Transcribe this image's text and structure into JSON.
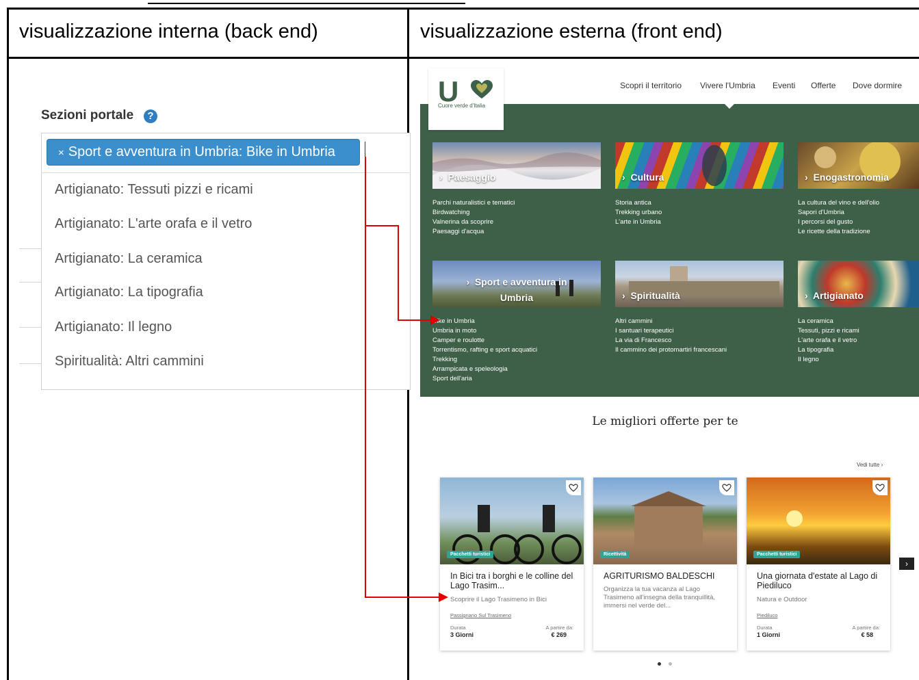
{
  "header": {
    "left_title": "visualizzazione interna (back end)",
    "right_title": "visualizzazione esterna (front end)"
  },
  "backend": {
    "field_label": "Sezioni portale",
    "help_icon": "question-circle-icon",
    "selected_chip": "Sport e avventura in Umbria: Bike in Umbria",
    "chip_remove": "×",
    "options": [
      "Artigianato: Tessuti pizzi e ricami",
      "Artigianato: L'arte orafa e il vetro",
      "Artigianato: La ceramica",
      "Artigianato: La tipografia",
      "Artigianato: Il legno",
      "Spiritualità: Altri cammini"
    ]
  },
  "frontend": {
    "logo": {
      "text": "U",
      "tagline": "Cuore verde d'Italia"
    },
    "nav": [
      "Scopri il territorio",
      "Vivere l'Umbria",
      "Eventi",
      "Offerte",
      "Dove dormire"
    ],
    "categories": [
      {
        "label": "Paesaggio",
        "items": [
          "Parchi naturalistici e tematici",
          "Birdwatching",
          "Valnerina da scoprire",
          "Paesaggi d'acqua"
        ]
      },
      {
        "label": "Cultura",
        "items": [
          "Storia antica",
          "Trekking urbano",
          "L'arte in Umbria"
        ]
      },
      {
        "label": "Enogastronomia",
        "items": [
          "La cultura del vino e dell'olio",
          "Sapori d'Umbria",
          "I percorsi del gusto",
          "Le ricette della tradizione"
        ]
      },
      {
        "label_line1": "Sport e avventura in",
        "label_line2": "Umbria",
        "items": [
          "Bike in Umbria",
          "Umbria in moto",
          "Camper e roulotte",
          "Torrentismo, rafting e sport acquatici",
          "Trekking",
          "Arrampicata e speleologia",
          "Sport dell'aria"
        ]
      },
      {
        "label": "Spiritualità",
        "items": [
          "Altri cammini",
          "I santuari terapeutici",
          "La via di Francesco",
          "Il cammino dei protomartiri francescani"
        ]
      },
      {
        "label": "Artigianato",
        "items": [
          "La ceramica",
          "Tessuti, pizzi e ricami",
          "L'arte orafa e il vetro",
          "La tipografia",
          "Il legno"
        ]
      }
    ],
    "offers_title": "Le migliori offerte per te",
    "see_all": "Vedi tutte",
    "cards": [
      {
        "badge": "Pacchetti turistici",
        "title": "In Bici tra i borghi e le colline del Lago Trasim...",
        "subtitle": "Scoprire il Lago Trasimeno in Bici",
        "place": "Passignano Sul Trasimeno",
        "duration_label": "Durata",
        "duration": "3 Giorni",
        "price_label": "A partire da:",
        "price": "€ 269"
      },
      {
        "badge": "Ricettività",
        "title": "AGRITURISMO BALDESCHI",
        "subtitle": "Organizza la tua vacanza al Lago Trasimeno all'insegna della tranquillità, immersi nel verde del..."
      },
      {
        "badge": "Pacchetti turistici",
        "title": "Una giornata d'estate al Lago di Piediluco",
        "subtitle": "Natura e Outdoor",
        "place": "Piediluco",
        "duration_label": "Durata",
        "duration": "1 Giorni",
        "price_label": "A partire da:",
        "price": "€ 58"
      }
    ]
  },
  "colors": {
    "green": "#3e5f48",
    "chip_blue": "#3b8fcc",
    "arrow_red": "#e00000",
    "badge_teal": "#2fa494"
  }
}
